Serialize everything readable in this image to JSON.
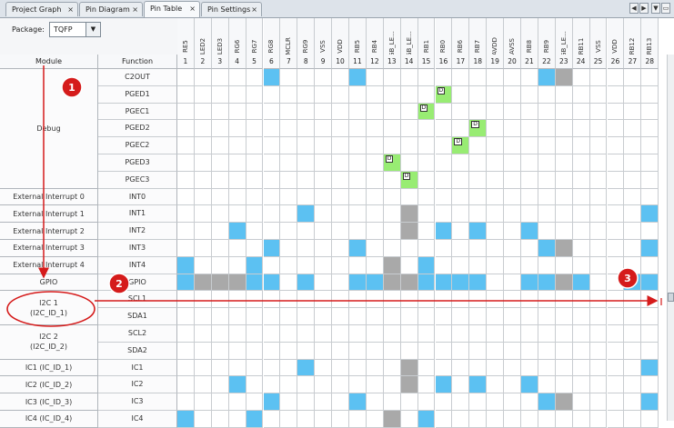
{
  "tabs": [
    {
      "label": "Project Graph",
      "active": false
    },
    {
      "label": "Pin Diagram",
      "active": false
    },
    {
      "label": "Pin Table",
      "active": true
    },
    {
      "label": "Pin Settings",
      "active": false
    }
  ],
  "tab_close_glyph": "×",
  "nav_icons": [
    "nav-left-icon",
    "nav-right-icon",
    "nav-down-icon",
    "nav-restore-icon"
  ],
  "nav_glyphs": [
    "◀",
    "▶",
    "▼",
    "▭"
  ],
  "package": {
    "label": "Package:",
    "value": "TQFP",
    "arrow": "▼"
  },
  "columns": {
    "module": "Module",
    "function": "Function"
  },
  "pins": [
    {
      "num": "1",
      "name": "RE5"
    },
    {
      "num": "2",
      "name": "LED2"
    },
    {
      "num": "3",
      "name": "LED3"
    },
    {
      "num": "4",
      "name": "RG6"
    },
    {
      "num": "5",
      "name": "RG7"
    },
    {
      "num": "6",
      "name": "RG8"
    },
    {
      "num": "7",
      "name": "MCLR"
    },
    {
      "num": "8",
      "name": "RG9"
    },
    {
      "num": "9",
      "name": "VSS"
    },
    {
      "num": "10",
      "name": "VDD"
    },
    {
      "num": "11",
      "name": "RB5"
    },
    {
      "num": "12",
      "name": "RB4"
    },
    {
      "num": "13",
      "name": "RGB_LE..."
    },
    {
      "num": "14",
      "name": "RGB_LE..."
    },
    {
      "num": "15",
      "name": "RB1"
    },
    {
      "num": "16",
      "name": "RB0"
    },
    {
      "num": "17",
      "name": "RB6"
    },
    {
      "num": "18",
      "name": "RB7"
    },
    {
      "num": "19",
      "name": "AVDD"
    },
    {
      "num": "20",
      "name": "AVSS"
    },
    {
      "num": "21",
      "name": "RB8"
    },
    {
      "num": "22",
      "name": "RB9"
    },
    {
      "num": "23",
      "name": "RGB_LE..."
    },
    {
      "num": "24",
      "name": "RB11"
    },
    {
      "num": "25",
      "name": "VSS"
    },
    {
      "num": "26",
      "name": "VDD"
    },
    {
      "num": "27",
      "name": "RB12"
    },
    {
      "num": "28",
      "name": "RB13"
    }
  ],
  "modules": [
    {
      "label": "Debug",
      "rows": 7
    },
    {
      "label": "External Interrupt 0",
      "rows": 1
    },
    {
      "label": "External Interrupt 1",
      "rows": 1
    },
    {
      "label": "External Interrupt 2",
      "rows": 1
    },
    {
      "label": "External Interrupt 3",
      "rows": 1
    },
    {
      "label": "External Interrupt 4",
      "rows": 1
    },
    {
      "label": "GPIO",
      "rows": 1
    },
    {
      "label": "I2C 1\n(I2C_ID_1)",
      "rows": 2
    },
    {
      "label": "I2C 2\n(I2C_ID_2)",
      "rows": 2
    },
    {
      "label": "IC1 (IC_ID_1)",
      "rows": 1
    },
    {
      "label": "IC2 (IC_ID_2)",
      "rows": 1
    },
    {
      "label": "IC3 (IC_ID_3)",
      "rows": 1
    },
    {
      "label": "IC4 (IC_ID_4)",
      "rows": 1
    }
  ],
  "rows": [
    {
      "function": "C2OUT",
      "blue": [
        6,
        11,
        22
      ],
      "gray": [
        23
      ],
      "green": [],
      "locked": []
    },
    {
      "function": "PGED1",
      "blue": [],
      "gray": [],
      "green": [
        16
      ],
      "locked": [
        16
      ]
    },
    {
      "function": "PGEC1",
      "blue": [],
      "gray": [],
      "green": [
        15
      ],
      "locked": [
        15
      ]
    },
    {
      "function": "PGED2",
      "blue": [],
      "gray": [],
      "green": [
        18
      ],
      "locked": [
        18
      ]
    },
    {
      "function": "PGEC2",
      "blue": [],
      "gray": [],
      "green": [
        17
      ],
      "locked": [
        17
      ]
    },
    {
      "function": "PGED3",
      "blue": [],
      "gray": [],
      "green": [
        13
      ],
      "locked": [
        13
      ]
    },
    {
      "function": "PGEC3",
      "blue": [],
      "gray": [],
      "green": [
        14
      ],
      "locked": [
        14
      ]
    },
    {
      "function": "INT0",
      "blue": [],
      "gray": [],
      "green": [],
      "locked": []
    },
    {
      "function": "INT1",
      "blue": [
        8,
        28
      ],
      "gray": [
        14
      ],
      "green": [],
      "locked": []
    },
    {
      "function": "INT2",
      "blue": [
        4,
        16,
        18,
        21
      ],
      "gray": [
        14
      ],
      "green": [],
      "locked": []
    },
    {
      "function": "INT3",
      "blue": [
        6,
        11,
        22,
        28
      ],
      "gray": [
        23
      ],
      "green": [],
      "locked": []
    },
    {
      "function": "INT4",
      "blue": [
        1,
        5,
        15
      ],
      "gray": [
        13
      ],
      "green": [],
      "locked": []
    },
    {
      "function": "GPIO",
      "blue": [
        1,
        5,
        6,
        8,
        11,
        12,
        15,
        16,
        17,
        18,
        21,
        22,
        24,
        27,
        28
      ],
      "gray": [
        2,
        3,
        4,
        13,
        14,
        23
      ],
      "green": [],
      "locked": []
    },
    {
      "function": "SCL1",
      "blue": [],
      "gray": [],
      "green": [],
      "locked": []
    },
    {
      "function": "SDA1",
      "blue": [],
      "gray": [],
      "green": [],
      "locked": []
    },
    {
      "function": "SCL2",
      "blue": [],
      "gray": [],
      "green": [],
      "locked": []
    },
    {
      "function": "SDA2",
      "blue": [],
      "gray": [],
      "green": [],
      "locked": []
    },
    {
      "function": "IC1",
      "blue": [
        8,
        28
      ],
      "gray": [
        14
      ],
      "green": [],
      "locked": []
    },
    {
      "function": "IC2",
      "blue": [
        4,
        16,
        18,
        21
      ],
      "gray": [
        14
      ],
      "green": [],
      "locked": []
    },
    {
      "function": "IC3",
      "blue": [
        6,
        11,
        22,
        28
      ],
      "gray": [
        23
      ],
      "green": [],
      "locked": []
    },
    {
      "function": "IC4",
      "blue": [
        1,
        5,
        15
      ],
      "gray": [
        13
      ],
      "green": [],
      "locked": []
    }
  ],
  "lock_glyph": "D",
  "callouts": [
    {
      "label": "1"
    },
    {
      "label": "2"
    },
    {
      "label": "3"
    }
  ],
  "colors": {
    "assigned": "#5cc1f2",
    "reserved": "#a9a9a9",
    "locked": "#98ec73",
    "annotation": "#d51b1b"
  }
}
